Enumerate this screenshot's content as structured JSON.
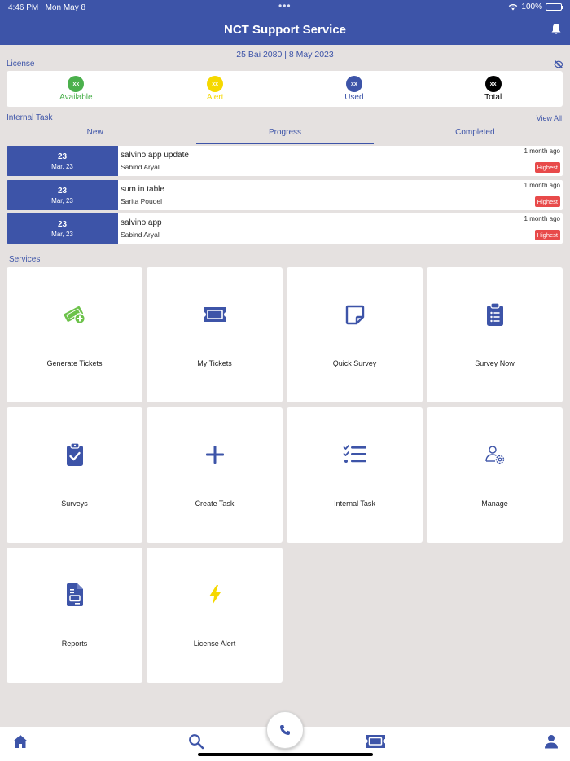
{
  "status_bar": {
    "time": "4:46 PM",
    "date": "Mon May 8",
    "dots": "•••",
    "battery": "100%"
  },
  "header": {
    "title": "NCT Support Service",
    "icon": "bell-icon"
  },
  "date_line": "25 Bai 2080 | 8 May 2023",
  "license": {
    "label": "License",
    "toggle_icon": "eye-off-icon",
    "items": [
      {
        "value": "xx",
        "label": "Available",
        "color": "#4bb04c"
      },
      {
        "value": "xx",
        "label": "Alert",
        "color": "#f5d800"
      },
      {
        "value": "xx",
        "label": "Used",
        "color": "#3d54a8"
      },
      {
        "value": "xx",
        "label": "Total",
        "color": "#000000"
      }
    ]
  },
  "internal_task": {
    "label": "Internal Task",
    "view_all": "View All",
    "tabs": [
      {
        "label": "New"
      },
      {
        "label": "Progress",
        "active": true
      },
      {
        "label": "Completed"
      }
    ],
    "tasks": [
      {
        "day": "23",
        "month": "Mar, 23",
        "title": "salvino app update",
        "assignee": "Sabind Aryal",
        "ago": "1 month ago",
        "priority": "Highest"
      },
      {
        "day": "23",
        "month": "Mar, 23",
        "title": "sum in table",
        "assignee": "Sarita Poudel",
        "ago": "1 month ago",
        "priority": "Highest"
      },
      {
        "day": "23",
        "month": "Mar, 23",
        "title": "salvino app",
        "assignee": "Sabind Aryal",
        "ago": "1 month ago",
        "priority": "Highest"
      }
    ]
  },
  "services": {
    "label": "Services",
    "items": [
      {
        "label": "Generate Tickets",
        "icon": "generate-ticket-icon"
      },
      {
        "label": "My Tickets",
        "icon": "ticket-icon"
      },
      {
        "label": "Quick Survey",
        "icon": "sticky-note-icon"
      },
      {
        "label": "Survey Now",
        "icon": "clipboard-list-icon"
      },
      {
        "label": "Surveys",
        "icon": "clipboard-check-icon"
      },
      {
        "label": "Create Task",
        "icon": "plus-icon"
      },
      {
        "label": "Internal Task",
        "icon": "checklist-icon"
      },
      {
        "label": "Manage",
        "icon": "user-settings-icon"
      },
      {
        "label": "Reports",
        "icon": "report-icon"
      },
      {
        "label": "License Alert",
        "icon": "lightning-icon"
      }
    ]
  },
  "bottom_nav": {
    "items": [
      "home-icon",
      "search-icon",
      "ticket-icon",
      "profile-icon"
    ],
    "fab_icon": "phone-icon"
  },
  "colors": {
    "primary": "#3d54a8",
    "background": "#e5e1e0",
    "priority": "#e84a4a",
    "generate_green": "#6cc24a",
    "alert_yellow": "#f5d800"
  }
}
